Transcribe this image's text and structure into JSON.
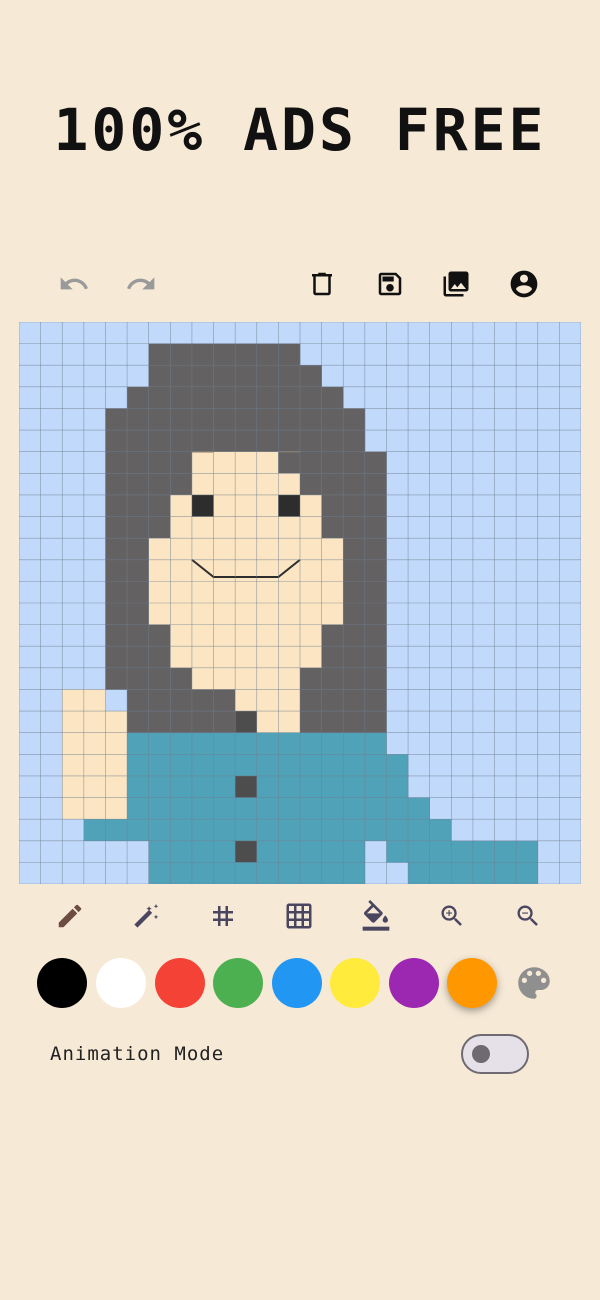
{
  "headline": "100% ADS FREE",
  "top_toolbar": {
    "undo_icon": "undo-icon",
    "redo_icon": "redo-icon",
    "delete_icon": "trash-icon",
    "save_icon": "save-icon",
    "gallery_icon": "gallery-icon",
    "account_icon": "account-icon"
  },
  "canvas": {
    "grid_size": 26,
    "palette": {
      ".": "#C1D9FA",
      "H": "#636162",
      "S": "#FCE5C3",
      "E": "#2D2D2D",
      "M": "#2D2D2D",
      "T": "#50A2B9",
      "B": "#4D4D4D"
    },
    "rows": [
      "..........................",
      "......HHHHHHH.............",
      "......HHHHHHHH............",
      ".....HHHHHHHHHH...........",
      "....HHHHHHHHHHHH..........",
      "....HHHHHHHHHHHH..........",
      "....HHHHSSSSHHHHH.........",
      "....HHHHSSSSSHHHH.........",
      "....HHHSSSSSSSHHH.........",
      "....HHHSSSSSSSHHH.........",
      "....HHSSSSSSSSSHH.........",
      "....HHSSSSSSSSSHH.........",
      "....HHSSSSSSSSSHH.........",
      "....HHSSSSSSSSSHH.........",
      "....HHHSSSSSSSHHH.........",
      "....HHHSSSSSSSHHH.........",
      "....HHHHSSSSSHHHH.........",
      "..SS.HHHHHSSSHHHH.........",
      "..SSSHHHHHSSSHHHH.........",
      "..SSSTTTTTTTTTTTT.........",
      "..SSSTTTTTTTTTTTTT........",
      "..SSSTTTTTTTTTTTTT........",
      "..SSSTTTTTTTTTTTTTT.......",
      "...TTTTTTTTTTTTTTTTT......",
      "...TTTTTTTTTTTTTTTTTT.....",
      "......TTTTTTTTTTTTTTTTTTT."
    ],
    "rows_extra": [
      "......TTTTTTTTTT.TTTTTTT..",
      "......TTTTTTTTTT..TTTTTT.."
    ],
    "buttons": [
      [
        10,
        18
      ],
      [
        10,
        21
      ],
      [
        10,
        24
      ]
    ],
    "eyes": [
      [
        8,
        8
      ],
      [
        12,
        8
      ]
    ]
  },
  "tools": {
    "pencil_icon": "pencil-icon",
    "magic_icon": "magic-wand-icon",
    "grid_icon": "grid-icon",
    "grid_on_icon": "grid-on-icon",
    "fill_icon": "fill-bucket-icon",
    "zoom_in_icon": "zoom-in-icon",
    "zoom_out_icon": "zoom-out-icon"
  },
  "swatches": [
    "#000000",
    "#FFFFFF",
    "#F44336",
    "#4CAF50",
    "#2196F3",
    "#FFEB3B",
    "#9C27B0",
    "#FF9800"
  ],
  "selected_swatch": "#FF9800",
  "palette_icon": "palette-icon",
  "animation": {
    "label": "Animation Mode",
    "enabled": false
  }
}
